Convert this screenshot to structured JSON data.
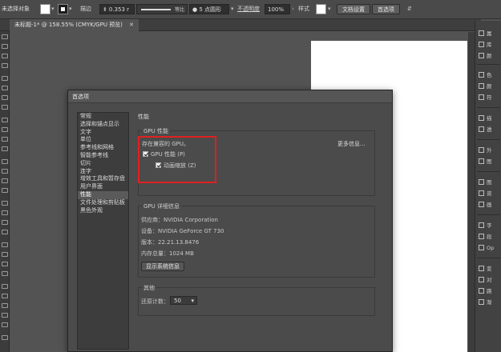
{
  "control_bar": {
    "selection_label": "未选择对象",
    "stroke_label": "描边",
    "stroke_value": "0.353 r",
    "stroke_style_label": "等比",
    "brush_label": "5 点圆形",
    "opacity_label": "不透明度",
    "opacity_value": "100%",
    "style_label": "样式",
    "doc_setup_button": "文档设置",
    "prefs_button": "首选项"
  },
  "tab_bar": {
    "doc_tab": "未标题-1* @ 158.55% (CMYK/GPU 预览)",
    "close_symbol": "✕"
  },
  "right_panel": {
    "items": [
      "属",
      "库",
      "颜",
      "色",
      "颜",
      "符",
      "描",
      "透",
      "外",
      "图",
      "图",
      "资",
      "画",
      "字",
      "段",
      "Op",
      "变",
      "对",
      "路",
      "渐"
    ]
  },
  "dialog": {
    "title": "首选项",
    "categories": [
      "常规",
      "选择和锚点显示",
      "文字",
      "单位",
      "参考线和网格",
      "智能参考线",
      "切片",
      "连字",
      "增效工具和暂存盘",
      "用户界面",
      "性能",
      "文件处理和剪贴板",
      "黑色外观"
    ],
    "active_category": "性能",
    "section_title": "性能",
    "gpu_group_label": "GPU 性能",
    "gpu_compatible": "存在兼容的 GPU。",
    "more_info": "更多信息...",
    "gpu_perf_checkbox": "GPU 性能 (P)",
    "anim_zoom_checkbox": "动画缩放 (Z)",
    "gpu_details_label": "GPU 详细信息",
    "vendor": "供应商：NVIDIA Corporation",
    "device": "设备：NVIDIA GeForce GT 730",
    "version": "版本：22.21.13.8476",
    "memory": "内存总量：1024 MB",
    "system_info_button": "显示系统信息",
    "other_label": "其他",
    "undo_label": "还原计数：",
    "undo_value": "50",
    "dropdown_arrow": "▾"
  }
}
